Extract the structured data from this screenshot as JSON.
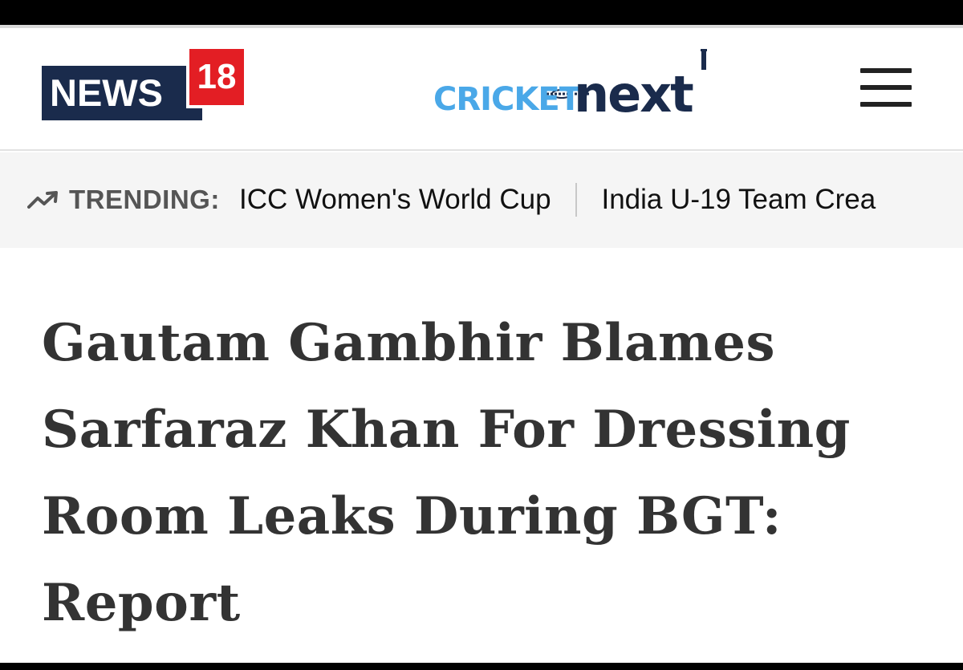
{
  "header": {
    "logo_news": "NEWS",
    "logo_number": "18",
    "site_logo_cricket": "CRICKET",
    "site_logo_next": "next",
    "menu_icon": "hamburger-menu-icon"
  },
  "trending": {
    "label": "TRENDING:",
    "icon": "trending-up-icon",
    "items": [
      "ICC Women's World Cup",
      "India U-19 Team Crea"
    ]
  },
  "article": {
    "headline": "Gautam Gambhir Blames Sarfaraz Khan For Dressing Room Leaks During BGT: Report"
  },
  "colors": {
    "news18_navy": "#1a2b4c",
    "news18_red": "#e31e24",
    "cricket_blue": "#4aa8e8",
    "headline_text": "#333333",
    "trending_bg": "#f5f5f5"
  }
}
